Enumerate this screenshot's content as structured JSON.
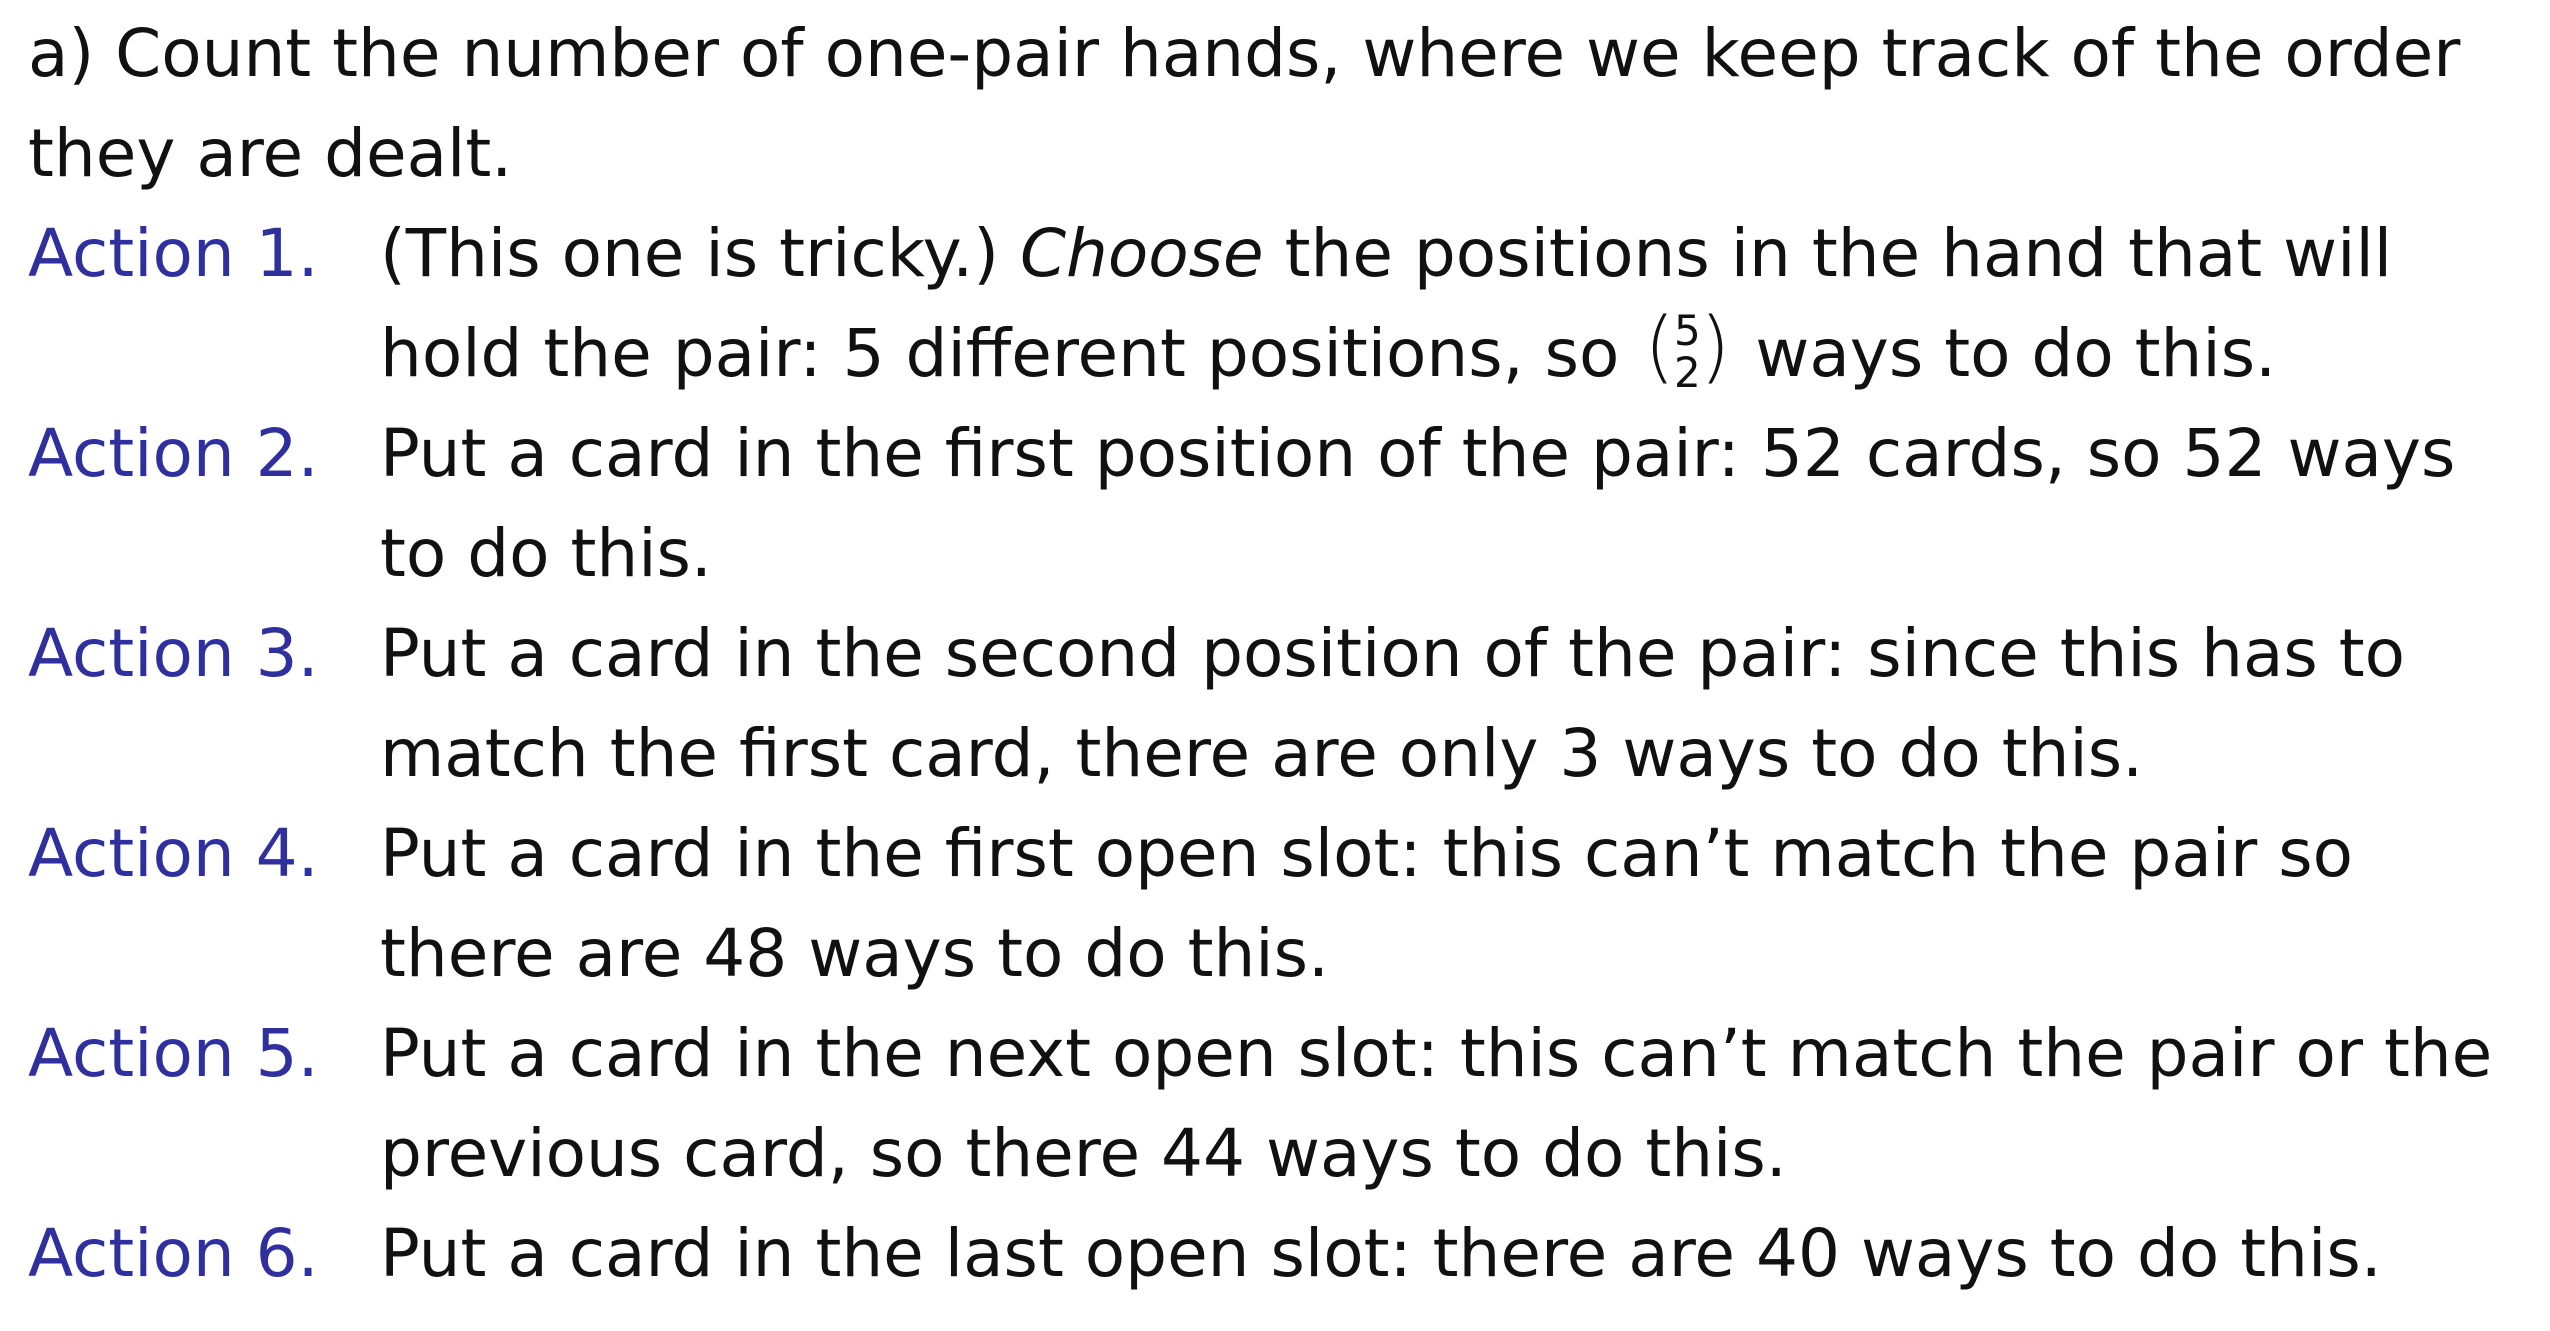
{
  "intro": "a) Count the number of one-pair hands, where we keep track of the order they are dealt.",
  "actions": [
    {
      "label": "Action 1.",
      "pre": "(This one is tricky.) ",
      "emph": "Choose",
      "post": " the positions in the hand that will hold the pair: 5 different positions, so",
      "binom_top": "5",
      "binom_bottom": "2",
      "tail": "ways to do this."
    },
    {
      "label": "Action 2.",
      "text": "Put a card in the first position of the pair: 52 cards, so 52 ways to do this."
    },
    {
      "label": "Action 3.",
      "text": "Put a card in the second position of the pair: since this has to match the first card, there are only 3 ways to do this."
    },
    {
      "label": "Action 4.",
      "text": "Put a card in the first open slot: this can’t match the pair so there are 48 ways to do this."
    },
    {
      "label": "Action 5.",
      "text": "Put a card in the next open slot: this can’t match the pair or the previous card, so there 44 ways to do this."
    },
    {
      "label": "Action 6.",
      "text": "Put a card in the last open slot: there are 40 ways to do this."
    }
  ],
  "colors": {
    "label": "#2f2f9e",
    "text": "#111111",
    "background": "#ffffff"
  }
}
